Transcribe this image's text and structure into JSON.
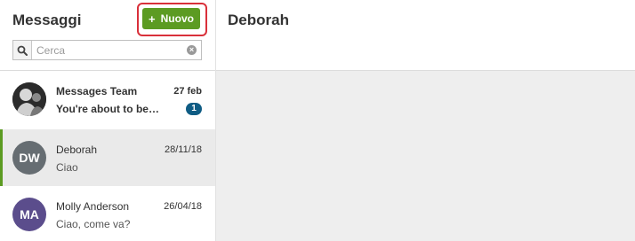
{
  "sidebar": {
    "title": "Messaggi",
    "new_button_label": "Nuovo",
    "new_button_plus": "+",
    "search": {
      "placeholder": "Cerca",
      "value": ""
    },
    "conversations": [
      {
        "name": "Messages Team",
        "preview": "You're about to be…",
        "date": "27 feb",
        "unread_count": "1",
        "avatar_type": "photo",
        "selected": false
      },
      {
        "name": "Deborah",
        "preview": "Ciao",
        "date": "28/11/18",
        "initials": "DW",
        "avatar_color": "#666d72",
        "selected": true
      },
      {
        "name": "Molly Anderson",
        "preview": "Ciao, come va?",
        "date": "26/04/18",
        "initials": "MA",
        "avatar_color": "#5b4d8c",
        "selected": false
      }
    ]
  },
  "main": {
    "title": "Deborah"
  },
  "colors": {
    "accent_green": "#5c9b22",
    "badge_blue": "#0f5c84",
    "highlight_red": "#d9303a"
  },
  "icons": {
    "search": "search-icon",
    "clear": "clear-icon"
  }
}
